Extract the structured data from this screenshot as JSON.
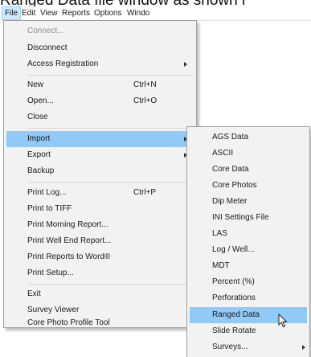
{
  "caption": "Ranged Data file window as shown i",
  "menubar": {
    "items": [
      {
        "label": "File"
      },
      {
        "label": "Edit"
      },
      {
        "label": "View"
      },
      {
        "label": "Reports"
      },
      {
        "label": "Options"
      },
      {
        "label": "Windo"
      }
    ]
  },
  "file_menu": {
    "connect": "Connect...",
    "disconnect": "Disconnect",
    "access_registration": "Access Registration",
    "new": "New",
    "new_shortcut": "Ctrl+N",
    "open": "Open...",
    "open_shortcut": "Ctrl+O",
    "close": "Close",
    "import": "Import",
    "export": "Export",
    "backup": "Backup",
    "print_log": "Print Log...",
    "print_log_shortcut": "Ctrl+P",
    "print_to_tiff": "Print to TIFF",
    "print_morning_report": "Print Morning Report...",
    "print_well_end_report": "Print Well End Report...",
    "print_reports_to_word": "Print Reports to Word®",
    "print_setup": "Print Setup...",
    "exit": "Exit",
    "survey_viewer": "Survey Viewer",
    "core_photo_profile_tool": "Core Photo Profile Tool"
  },
  "import_menu": {
    "items": [
      "AGS Data",
      "ASCII",
      "Core Data",
      "Core Photos",
      "Dip Meter",
      "INI Settings File",
      "LAS",
      "Log / Well...",
      "MDT",
      "Percent (%)",
      "Perforations",
      "Ranged Data",
      "Slide Rotate",
      "Surveys..."
    ],
    "highlighted": "Ranged Data"
  },
  "colors": {
    "menu_bg": "#f2f2f2",
    "highlight": "#91c9f7",
    "menubar_active": "#cde8ff",
    "disabled_text": "#8d8d8d"
  }
}
